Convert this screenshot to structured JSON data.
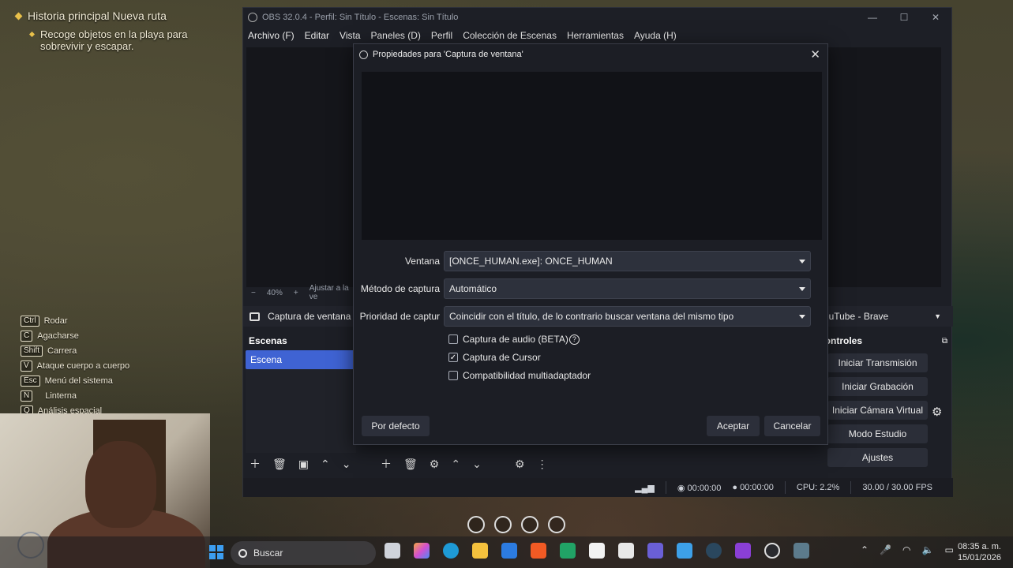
{
  "game": {
    "quest_title": "Historia principal Nueva ruta",
    "quest_objective_line1": "Recoge objetos en la playa para",
    "quest_objective_line2": "sobrevivir y escapar.",
    "keys": [
      {
        "key": "Ctrl",
        "action": "Rodar"
      },
      {
        "key": "C",
        "action": "Agacharse"
      },
      {
        "key": "Shift",
        "action": "Carrera"
      },
      {
        "key": "V",
        "action": "Ataque cuerpo a cuerpo"
      },
      {
        "key": "Esc",
        "action": "Menú del sistema"
      },
      {
        "key": "N",
        "action": "Linterna"
      },
      {
        "key": "Q",
        "action": "Análisis espacial"
      }
    ]
  },
  "obs": {
    "title": "OBS 32.0.4 - Perfil: Sin Título - Escenas: Sin Título",
    "menu": [
      "Archivo (F)",
      "Editar",
      "Vista",
      "Paneles (D)",
      "Perfil",
      "Colección de Escenas",
      "Herramientas",
      "Ayuda (H)"
    ],
    "zoom_minus": "−",
    "zoom_value": "40%",
    "zoom_plus": "+",
    "zoom_fit": "Ajustar a la ve",
    "source_name": "Captura de ventana",
    "brave_label": "YouTube - Brave",
    "scenes_header": "Escenas",
    "scene_item": "Escena",
    "controls_header": "Controles",
    "controls": [
      "Iniciar Transmisión",
      "Iniciar Grabación",
      "Iniciar Cámara Virtual",
      "Modo Estudio",
      "Ajustes"
    ],
    "status": {
      "stream_time": "00:00:00",
      "rec_time": "00:00:00",
      "cpu": "CPU: 2.2%",
      "fps": "30.00 / 30.00 FPS"
    }
  },
  "dialog": {
    "title": "Propiedades para 'Captura de ventana'",
    "window_label": "Ventana",
    "window_value": "[ONCE_HUMAN.exe]: ONCE_HUMAN",
    "method_label": "Método de captura",
    "method_value": "Automático",
    "priority_label": "Prioridad de captur",
    "priority_value": "Coincidir con el título, de lo contrario buscar ventana del mismo tipo",
    "audio_label": "Captura de audio (BETA)",
    "audio_checked": false,
    "cursor_label": "Captura de Cursor",
    "cursor_checked": true,
    "multiadapter_label": "Compatibilidad multiadaptador",
    "multiadapter_checked": false,
    "defaults_button": "Por defecto",
    "ok_button": "Aceptar",
    "cancel_button": "Cancelar"
  },
  "taskbar": {
    "search_placeholder": "Buscar",
    "time": "08:35 a. m.",
    "date": "15/01/2026"
  },
  "colors": {
    "accent": "#3f63d3",
    "obs_bg": "#1d1f26",
    "dialog_bg": "#1c1e25",
    "quest_gold": "#e9c14a"
  }
}
